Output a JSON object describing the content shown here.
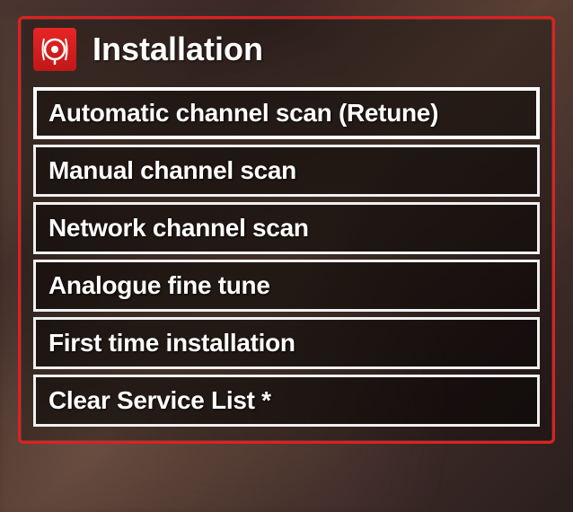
{
  "header": {
    "title": "Installation",
    "icon": "satellite-dish-icon"
  },
  "menu_items": [
    {
      "label": "Automatic channel scan (Retune)",
      "selected": true
    },
    {
      "label": "Manual channel scan",
      "selected": false
    },
    {
      "label": "Network channel scan",
      "selected": false
    },
    {
      "label": "Analogue fine tune",
      "selected": false
    },
    {
      "label": "First time installation",
      "selected": false
    },
    {
      "label": "Clear Service List *",
      "selected": false
    }
  ]
}
